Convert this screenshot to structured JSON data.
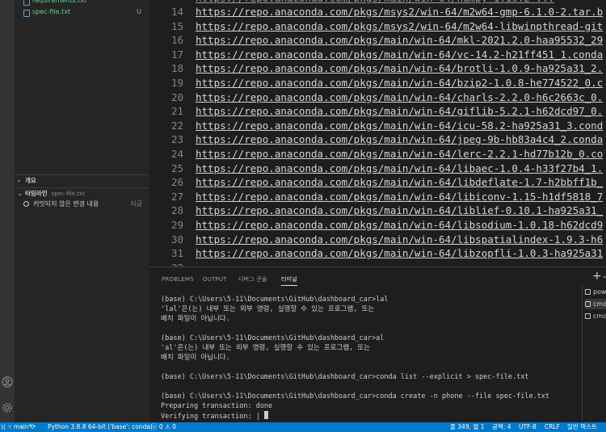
{
  "sidebar": {
    "files": [
      {
        "name": "requirements.txt",
        "badge": ""
      },
      {
        "name": "spec-file.txt",
        "badge": "U"
      }
    ],
    "outline_title": "개요",
    "timeline_title": "타임라인",
    "timeline_file": "spec-file.txt",
    "timeline_item_label": "커밋되지 않은 변경 내용",
    "timeline_item_time": "지금"
  },
  "editor": {
    "lines": [
      {
        "num": "14",
        "text": "https://repo.anaconda.com/pkgs/msys2/win-64/m2w64-gmp-6.1.0-2.tar.b"
      },
      {
        "num": "15",
        "text": "https://repo.anaconda.com/pkgs/msys2/win-64/m2w64-libwinpthread-git"
      },
      {
        "num": "16",
        "text": "https://repo.anaconda.com/pkgs/main/win-64/mkl-2021.2.0-haa95532_29"
      },
      {
        "num": "17",
        "text": "https://repo.anaconda.com/pkgs/main/win-64/vc-14.2-h21ff451_1.conda"
      },
      {
        "num": "18",
        "text": "https://repo.anaconda.com/pkgs/main/win-64/brotli-1.0.9-ha925a31_2."
      },
      {
        "num": "19",
        "text": "https://repo.anaconda.com/pkgs/main/win-64/bzip2-1.0.8-he774522_0.c"
      },
      {
        "num": "20",
        "text": "https://repo.anaconda.com/pkgs/main/win-64/charls-2.2.0-h6c2663c_0."
      },
      {
        "num": "21",
        "text": "https://repo.anaconda.com/pkgs/main/win-64/giflib-5.2.1-h62dcd97_0."
      },
      {
        "num": "22",
        "text": "https://repo.anaconda.com/pkgs/main/win-64/icu-58.2-ha925a31_3.cond"
      },
      {
        "num": "23",
        "text": "https://repo.anaconda.com/pkgs/main/win-64/jpeg-9b-hb83a4c4_2.conda"
      },
      {
        "num": "24",
        "text": "https://repo.anaconda.com/pkgs/main/win-64/lerc-2.2.1-hd77b12b_0.co"
      },
      {
        "num": "25",
        "text": "https://repo.anaconda.com/pkgs/main/win-64/libaec-1.0.4-h33f27b4_1."
      },
      {
        "num": "26",
        "text": "https://repo.anaconda.com/pkgs/main/win-64/libdeflate-1.7-h2bbff1b_"
      },
      {
        "num": "27",
        "text": "https://repo.anaconda.com/pkgs/main/win-64/libiconv-1.15-h1df5818_7"
      },
      {
        "num": "28",
        "text": "https://repo.anaconda.com/pkgs/main/win-64/liblief-0.10.1-ha925a31_"
      },
      {
        "num": "29",
        "text": "https://repo.anaconda.com/pkgs/main/win-64/libsodium-1.0.18-h62dcd9"
      },
      {
        "num": "30",
        "text": "https://repo.anaconda.com/pkgs/main/win-64/libspatialindex-1.9.3-h6"
      },
      {
        "num": "31",
        "text": "https://repo.anaconda.com/pkgs/main/win-64/libzopfli-1.0.3-ha925a31"
      }
    ]
  },
  "panel": {
    "tabs": [
      "PROBLEMS",
      "OUTPUT",
      "디버그 콘솔",
      "터미널"
    ],
    "active_tab_index": 3,
    "terminal_lines": [
      "(base) C:\\Users\\5-11\\Documents\\GitHub\\dashboard_car>lal",
      "'lal'은(는) 내부 또는 외부 명령, 실행할 수 있는 프로그램, 또는",
      "배치 파일이 아닙니다.",
      "",
      "(base) C:\\Users\\5-11\\Documents\\GitHub\\dashboard_car>al",
      "'al'은(는) 내부 또는 외부 명령, 실행할 수 있는 프로그램, 또는",
      "배치 파일이 아닙니다.",
      "",
      "(base) C:\\Users\\5-11\\Documents\\GitHub\\dashboard_car>conda list --explicit > spec-file.txt",
      "",
      "(base) C:\\Users\\5-11\\Documents\\GitHub\\dashboard_car>conda create -n phone --file spec-file.txt",
      "Preparing transaction: done",
      "Verifying transaction: |"
    ],
    "terminal_list": [
      "pow",
      "cmd",
      "cmd"
    ]
  },
  "statusbar": {
    "branch": "main*",
    "python": "Python 3.8.8 64-bit ('base': conda)",
    "errors": "0",
    "warnings": "0",
    "position": "줄 349, 열 1",
    "spaces": "공백: 4",
    "encoding": "UTF-8",
    "eol": "CRLF",
    "language": "일반 텍스트"
  },
  "colors": {
    "statusbar": "#007acc",
    "sidebar": "#252526",
    "editor": "#1e1e1e",
    "untracked": "#73c991"
  }
}
